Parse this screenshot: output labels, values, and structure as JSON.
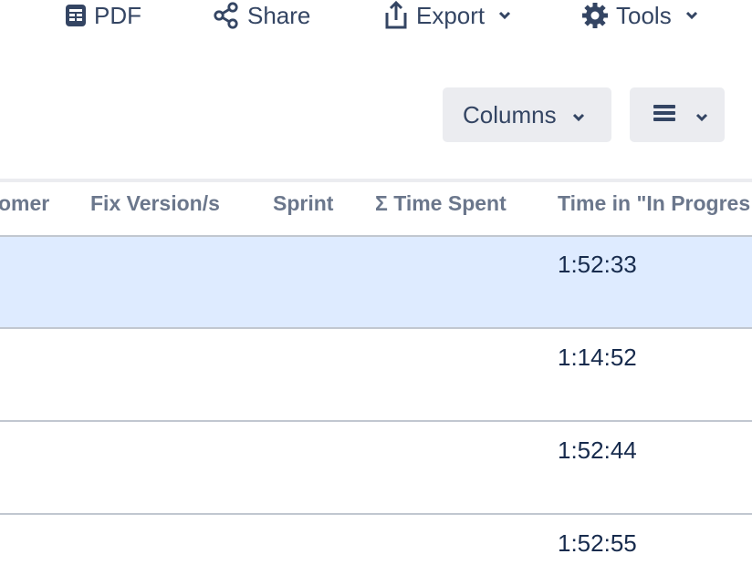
{
  "toolbar": {
    "pdf_label": "PDF",
    "share_label": "Share",
    "export_label": "Export",
    "tools_label": "Tools"
  },
  "controls": {
    "columns_label": "Columns"
  },
  "table": {
    "headers": [
      "omer",
      "Fix Version/s",
      "Sprint",
      "Σ Time Spent",
      "Time in \"In Progres"
    ],
    "rows": [
      {
        "time_in_progress": "1:52:33",
        "selected": true
      },
      {
        "time_in_progress": "1:14:52",
        "selected": false
      },
      {
        "time_in_progress": "1:52:44",
        "selected": false
      },
      {
        "time_in_progress": "1:52:55",
        "selected": false
      }
    ]
  },
  "colors": {
    "text": "#344563",
    "header_text": "#6b778c",
    "selected_row": "#deebff",
    "button_bg": "#ebecf0",
    "rule": "#c1c7d0"
  },
  "icons": [
    "pdf-icon",
    "share-icon",
    "export-icon",
    "gear-icon",
    "chevron-down-icon",
    "list-icon"
  ]
}
